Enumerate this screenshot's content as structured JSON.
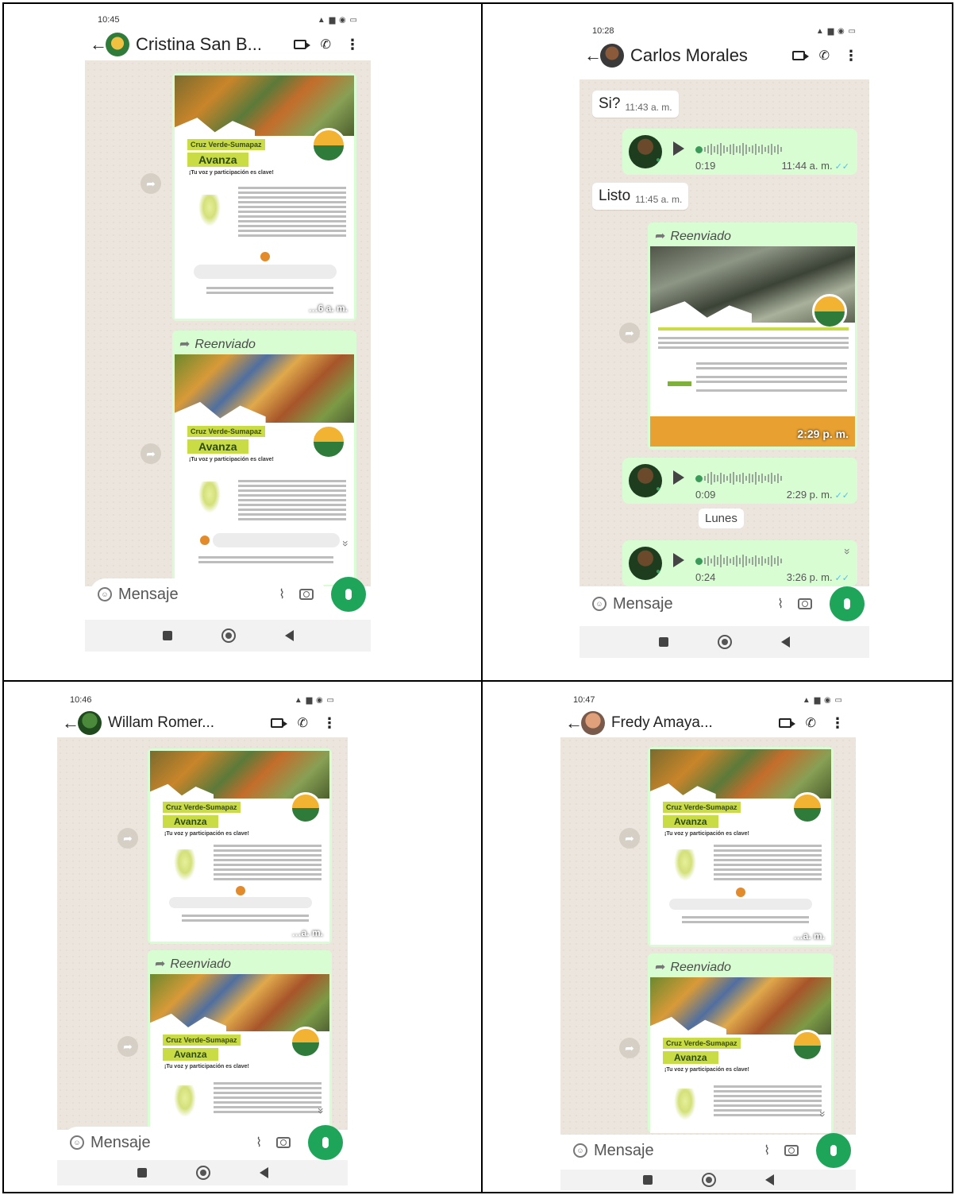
{
  "panels": {
    "cristina": {
      "status_time": "10:45",
      "contact_name": "Cristina San B...",
      "avatar_color": "#e0a030",
      "poster_tag": "Cruz Verde-Sumapaz",
      "poster_title": "Avanza",
      "poster_sub": "¡Tu voz y participación es clave!",
      "forwarded": "Reenviado",
      "time_partial": "…6 a. m.",
      "placeholder": "Mensaje"
    },
    "carlos": {
      "status_time": "10:28",
      "contact_name": "Carlos Morales",
      "avatar_color": "#6a4a2a",
      "messages": [
        {
          "text": "Si?",
          "time": "11:43 a. m."
        },
        {
          "text": "Listo",
          "time": "11:45 a. m."
        }
      ],
      "audio1": {
        "duration": "0:19",
        "time": "11:44 a. m."
      },
      "forwarded": "Reenviado",
      "poster_time": "2:29 p. m.",
      "audio2": {
        "duration": "0:09",
        "time": "2:29 p. m."
      },
      "date_chip": "Lunes",
      "audio3": {
        "duration": "0:24",
        "time": "3:26 p. m."
      },
      "placeholder": "Mensaje"
    },
    "willam": {
      "status_time": "10:46",
      "contact_name": "Willam Romer...",
      "avatar_color": "#2e6b2e",
      "poster_tag": "Cruz Verde-Sumapaz",
      "poster_title": "Avanza",
      "poster_sub": "¡Tu voz y participación es clave!",
      "forwarded": "Reenviado",
      "time_partial": "…a. m.",
      "placeholder": "Mensaje"
    },
    "fredy": {
      "status_time": "10:47",
      "contact_name": "Fredy Amaya...",
      "avatar_color": "#c9845a",
      "poster_tag": "Cruz Verde-Sumapaz",
      "poster_title": "Avanza",
      "poster_sub": "¡Tu voz y participación es clave!",
      "forwarded": "Reenviado",
      "time_partial": "…a. m.",
      "placeholder": "Mensaje"
    }
  },
  "icons": {
    "back": "←",
    "call": "✆",
    "menu": "⋮",
    "forward": "➦",
    "clip": "📎",
    "chevron_down": "»"
  },
  "colors": {
    "chat_bg": "#ece5dd",
    "bubble_out": "#d9fdd3",
    "whatsapp_green": "#1ea55a",
    "poster_lime": "#c9dc45",
    "poster_orange": "#e38a2b"
  }
}
